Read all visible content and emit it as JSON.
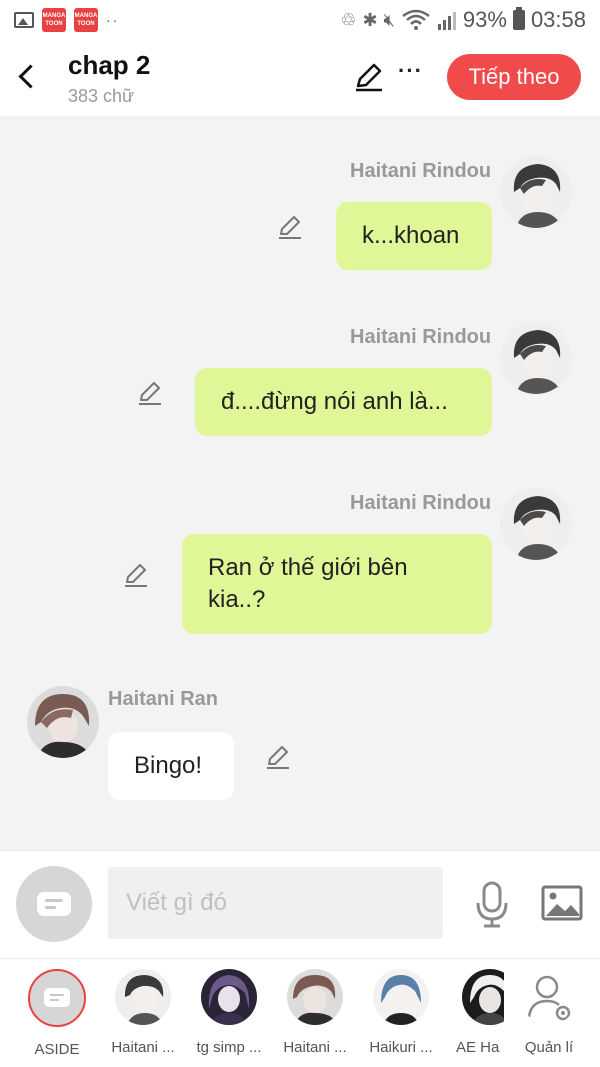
{
  "status_bar": {
    "app_logo_text": "MANGA TOON",
    "dots": "··",
    "battery": "93%",
    "time": "03:58"
  },
  "header": {
    "title": "chap 2",
    "word_count": "383 chữ",
    "next_button": "Tiếp theo"
  },
  "messages": [
    {
      "sender": "Haitani Rindou",
      "text": "k...khoan",
      "side": "right"
    },
    {
      "sender": "Haitani Rindou",
      "text": "đ....đừng nói anh là...",
      "side": "right"
    },
    {
      "sender": "Haitani Rindou",
      "text": "Ran ở thế giới bên kia..?",
      "side": "right"
    },
    {
      "sender": "Haitani Ran",
      "text": "Bingo!",
      "side": "left"
    }
  ],
  "input": {
    "placeholder": "Viết gì đó"
  },
  "characters": [
    {
      "label": "ASIDE",
      "selected": true
    },
    {
      "label": "Haitani ..."
    },
    {
      "label": "tg simp ..."
    },
    {
      "label": "Haitani ..."
    },
    {
      "label": "Haikuri ..."
    },
    {
      "label": "AE Ha"
    },
    {
      "label": "Quản lí"
    }
  ],
  "colors": {
    "accent": "#f14a4a",
    "bubble_right": "#dff796",
    "bubble_left": "#ffffff",
    "background": "#f3f3f3"
  }
}
